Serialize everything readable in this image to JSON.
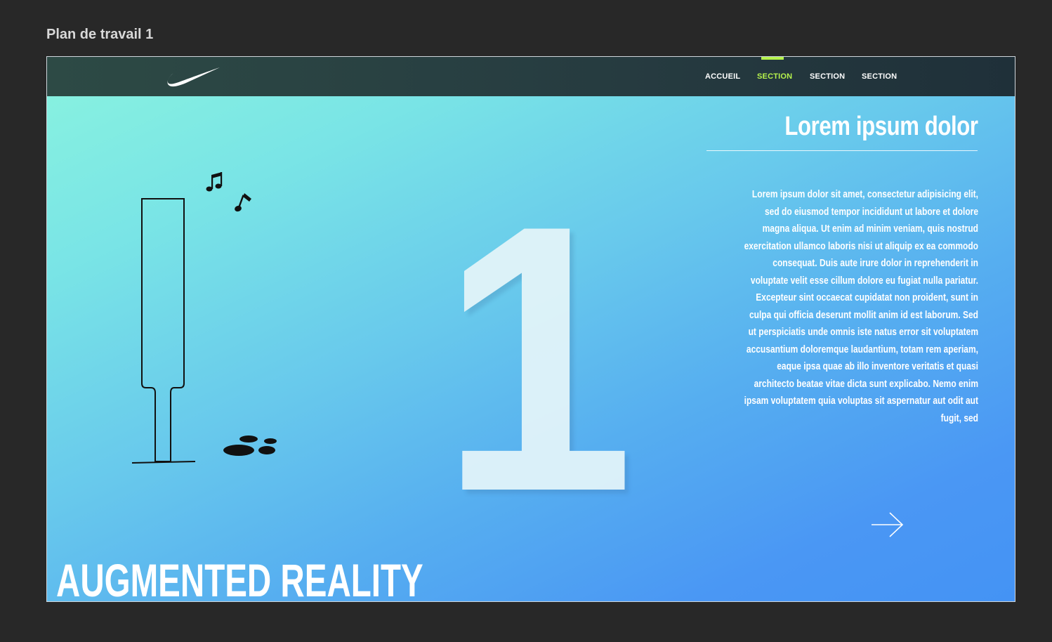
{
  "artboard": {
    "label": "Plan de travail 1"
  },
  "nav": {
    "items": [
      {
        "label": "ACCUEIL",
        "active": false
      },
      {
        "label": "SECTION",
        "active": true
      },
      {
        "label": "SECTION",
        "active": false
      },
      {
        "label": "SECTION",
        "active": false
      }
    ]
  },
  "hero": {
    "heading": "Lorem ipsum dolor",
    "body": "Lorem ipsum dolor sit amet, consectetur adipisicing elit, sed do eiusmod tempor incididunt ut labore et dolore magna aliqua. Ut enim ad minim veniam, quis nostrud exercitation ullamco laboris nisi ut aliquip ex ea commodo consequat. Duis aute irure dolor in reprehenderit in voluptate velit esse cillum dolore eu fugiat nulla pariatur. Excepteur sint occaecat cupidatat non proident, sunt in culpa qui officia deserunt mollit anim id est laborum. Sed ut perspiciatis unde omnis iste natus error sit voluptatem accusantium doloremque laudantium, totam rem aperiam, eaque ipsa quae ab illo inventore veritatis et quasi architecto beatae vitae dicta sunt explicabo. Nemo enim ipsam voluptatem quia voluptas sit aspernatur aut odit aut fugit, sed",
    "slide_number": "1",
    "title": "AUGMENTED REALITY"
  },
  "icons": {
    "logo": "nike-swoosh-logo",
    "illustration": "glass-music-notes-footprints",
    "next": "arrow-right-icon"
  },
  "colors": {
    "background": "#282828",
    "nav_active": "#b6f24c",
    "gradient_start": "#8af3df",
    "gradient_end": "#4493f4"
  }
}
